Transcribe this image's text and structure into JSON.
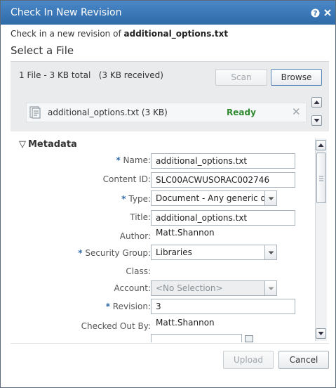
{
  "dialog": {
    "title": "Check In New Revision",
    "intro_prefix": "Check in a new revision of",
    "intro_filename": "additional_options.txt",
    "section_title": "Select a File"
  },
  "files": {
    "summary": "1 File - 3 KB total   (3 KB received)",
    "scan_label": "Scan",
    "browse_label": "Browse",
    "item": {
      "name": "additional_options.txt (3 KB)",
      "status": "Ready",
      "remove_glyph": "✕"
    }
  },
  "metadata": {
    "header": "Metadata",
    "toggle_glyph": "▽",
    "required_marker": "*",
    "fields": {
      "name": {
        "label": "Name:",
        "value": "additional_options.txt"
      },
      "content_id": {
        "label": "Content ID:",
        "value": "SLC00ACWUSORAC002746"
      },
      "type": {
        "label": "Type:",
        "value": "Document - Any generic doc"
      },
      "title": {
        "label": "Title:",
        "value": "additional_options.txt"
      },
      "author": {
        "label": "Author:",
        "value": "Matt.Shannon"
      },
      "security_group": {
        "label": "Security Group:",
        "value": "Libraries"
      },
      "class": {
        "label": "Class:",
        "value": ""
      },
      "account": {
        "label": "Account:",
        "value": "<No Selection>"
      },
      "revision": {
        "label": "Revision:",
        "value": "3"
      },
      "checked_out_by": {
        "label": "Checked Out By:",
        "value": "Matt.Shannon"
      }
    }
  },
  "footer": {
    "upload_label": "Upload",
    "cancel_label": "Cancel"
  },
  "icons": {
    "help": "help-icon",
    "close": "close-icon",
    "document": "document-icon"
  },
  "colors": {
    "titlebar": "#3a78b8",
    "ready": "#2f8a2f",
    "required": "#2f6aa8"
  }
}
